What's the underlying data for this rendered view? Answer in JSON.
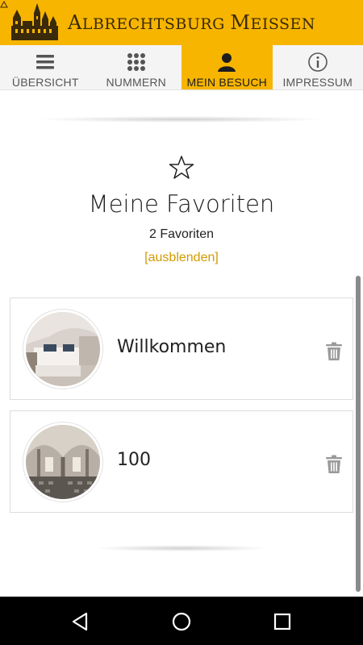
{
  "header": {
    "brand_part1": "A",
    "brand_part2": "LBRECHTSBURG ",
    "brand_part3": "M",
    "brand_part4": "EISSEN",
    "logo_icon": "castle-icon",
    "accent_color": "#f7b500"
  },
  "tabs": [
    {
      "label": "ÜBERSICHT",
      "icon": "menu-icon",
      "active": false
    },
    {
      "label": "NUMMERN",
      "icon": "grid-icon",
      "active": false
    },
    {
      "label": "MEIN BESUCH",
      "icon": "person-icon",
      "active": true
    },
    {
      "label": "IMPRESSUM",
      "icon": "info-icon",
      "active": false
    }
  ],
  "favorites": {
    "icon": "star-icon",
    "title": "Meine Favoriten",
    "count_text": "2 Favoriten",
    "toggle_label": "[ausblenden]",
    "items": [
      {
        "label": "Willkommen",
        "thumb_icon": "room-photo",
        "action_icon": "trash-icon"
      },
      {
        "label": "100",
        "thumb_icon": "hall-photo",
        "action_icon": "trash-icon"
      }
    ]
  },
  "navbar": {
    "back_icon": "back-icon",
    "home_icon": "home-icon",
    "recents_icon": "recents-icon"
  }
}
